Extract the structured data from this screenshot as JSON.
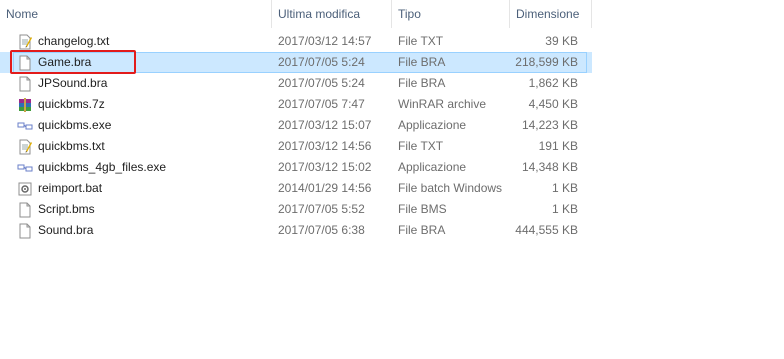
{
  "columns": {
    "name": "Nome",
    "modified": "Ultima modifica",
    "type": "Tipo",
    "size": "Dimensione"
  },
  "files": [
    {
      "name": "changelog.txt",
      "modified": "2017/03/12 14:57",
      "type": "File TXT",
      "size": "39 KB",
      "icon": "text-file-icon"
    },
    {
      "name": "Game.bra",
      "modified": "2017/07/05 5:24",
      "type": "File BRA",
      "size": "218,599 KB",
      "icon": "generic-file-icon",
      "selected": true
    },
    {
      "name": "JPSound.bra",
      "modified": "2017/07/05 5:24",
      "type": "File BRA",
      "size": "1,862 KB",
      "icon": "generic-file-icon"
    },
    {
      "name": "quickbms.7z",
      "modified": "2017/07/05 7:47",
      "type": "WinRAR archive",
      "size": "4,450 KB",
      "icon": "winrar-archive-icon"
    },
    {
      "name": "quickbms.exe",
      "modified": "2017/03/12 15:07",
      "type": "Applicazione",
      "size": "14,223 KB",
      "icon": "application-icon"
    },
    {
      "name": "quickbms.txt",
      "modified": "2017/03/12 14:56",
      "type": "File TXT",
      "size": "191 KB",
      "icon": "text-file-icon"
    },
    {
      "name": "quickbms_4gb_files.exe",
      "modified": "2017/03/12 15:02",
      "type": "Applicazione",
      "size": "14,348 KB",
      "icon": "application-icon"
    },
    {
      "name": "reimport.bat",
      "modified": "2014/01/29 14:56",
      "type": "File batch Windows",
      "size": "1 KB",
      "icon": "batch-file-icon"
    },
    {
      "name": "Script.bms",
      "modified": "2017/07/05 5:52",
      "type": "File BMS",
      "size": "1 KB",
      "icon": "generic-file-icon"
    },
    {
      "name": "Sound.bra",
      "modified": "2017/07/05 6:38",
      "type": "File BRA",
      "size": "444,555 KB",
      "icon": "generic-file-icon"
    }
  ],
  "colors": {
    "selection": "#cce8ff",
    "annotation": "#e21b1b"
  }
}
